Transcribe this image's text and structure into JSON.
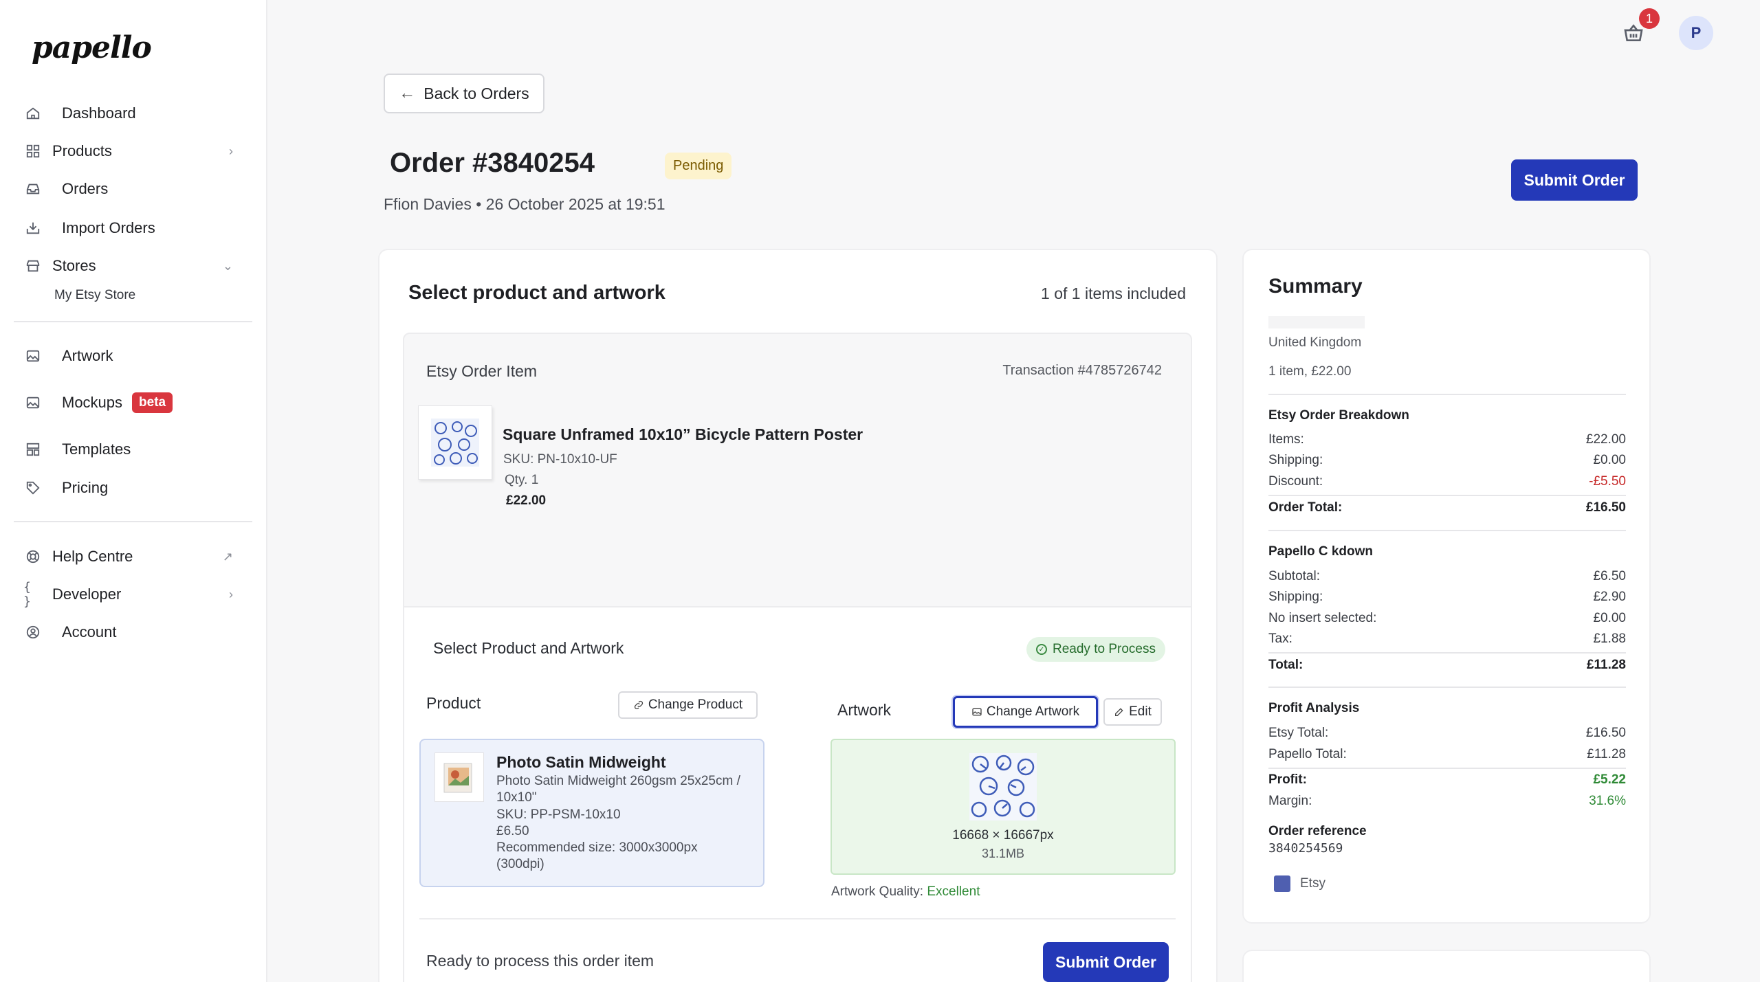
{
  "brand": {
    "logo": "papello"
  },
  "sidebar": {
    "items": [
      {
        "label": "Dashboard",
        "icon": "home-icon"
      },
      {
        "label": "Products",
        "icon": "grid-icon"
      },
      {
        "label": "Orders",
        "icon": "inbox-icon"
      },
      {
        "label": "Import Orders",
        "icon": "download-icon"
      },
      {
        "label": "Stores",
        "icon": "store-icon"
      },
      {
        "label": "Artwork",
        "icon": "image-icon"
      },
      {
        "label": "Mockups",
        "icon": "mockup-icon",
        "badge": "beta"
      },
      {
        "label": "Templates",
        "icon": "template-icon"
      },
      {
        "label": "Pricing",
        "icon": "tag-icon"
      },
      {
        "label": "Help Centre",
        "icon": "lifebuoy-icon"
      },
      {
        "label": "Developer",
        "icon": "braces-icon"
      },
      {
        "label": "Account",
        "icon": "user-circle-icon"
      }
    ],
    "store_sub": "My Etsy Store",
    "glyphs": {
      "chevron_right": "›",
      "chevron_down": "⌄",
      "external": "↗",
      "braces": "{ }"
    }
  },
  "topbar": {
    "cart_count": "1",
    "avatar_initial": "P"
  },
  "header": {
    "back_label": "Back to Orders",
    "order_title": "Order #3840254",
    "status": "Pending",
    "meta": "Ffion Davies • 26 October 2025 at 19:51",
    "submit_label": "Submit Order"
  },
  "main": {
    "title": "Select product and artwork",
    "items_count": "1 of 1 items included",
    "etsy_label": "Etsy Order Item",
    "transaction": "Transaction #4785726742",
    "product": {
      "name": "Square Unframed 10x10” Bicycle Pattern Poster",
      "sku": "SKU: PN-10x10-UF",
      "qty": "Qty. 1",
      "price": "£22.00"
    },
    "section_title": "Select Product and Artwork",
    "ready_badge": "Ready to Process",
    "product_label": "Product",
    "change_product": "Change Product",
    "artwork_label": "Artwork",
    "change_artwork": "Change Artwork",
    "edit": "Edit",
    "selected_product": {
      "name": "Photo Satin Midweight",
      "desc": "Photo Satin Midweight 260gsm 25x25cm / 10x10\"",
      "sku": "SKU: PP-PSM-10x10",
      "price": "£6.50",
      "recommended": "Recommended size: 3000x3000px (300dpi)"
    },
    "artwork": {
      "dimensions": "16668 × 16667px",
      "size": "31.1MB",
      "quality_label": "Artwork Quality:",
      "quality_value": "Excellent"
    },
    "ready_text": "Ready to process this order item",
    "submit_label": "Submit Order"
  },
  "summary": {
    "title": "Summary",
    "country": "United Kingdom",
    "items_line": "1 item, £22.00",
    "etsy_heading": "Etsy Order Breakdown",
    "etsy_rows": [
      {
        "label": "Items:",
        "value": "£22.00"
      },
      {
        "label": "Shipping:",
        "value": "£0.00"
      },
      {
        "label": "Discount:",
        "value": "-£5.50"
      }
    ],
    "etsy_total": {
      "label": "Order Total:",
      "value": "£16.50"
    },
    "papello_heading": "Papello C   kdown",
    "papello_rows": [
      {
        "label": "Subtotal:",
        "value": "£6.50"
      },
      {
        "label": "Shipping:",
        "value": "£2.90"
      },
      {
        "label": "No insert selected:",
        "value": "£0.00"
      },
      {
        "label": "Tax:",
        "value": "£1.88"
      }
    ],
    "papello_total": {
      "label": "Total:",
      "value": "£11.28"
    },
    "profit_heading": "Profit Analysis",
    "profit_rows": [
      {
        "label": "Etsy Total:",
        "value": "£16.50"
      },
      {
        "label": "Papello Total:",
        "value": "£11.28"
      }
    ],
    "profit": {
      "label": "Profit:",
      "value": "£5.22"
    },
    "margin": {
      "label": "Margin:",
      "value": "31.6%"
    },
    "ref_heading": "Order reference",
    "ref_value": "3840254569",
    "channel": "Etsy"
  },
  "colors": {
    "primary": "#2439b8",
    "danger": "#d9363e",
    "success": "#2f8a36"
  }
}
